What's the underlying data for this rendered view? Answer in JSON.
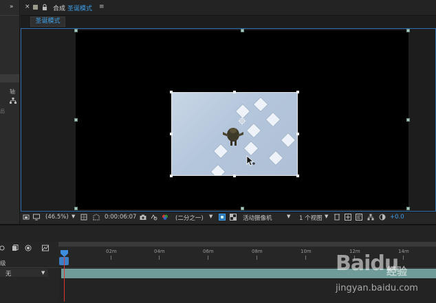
{
  "left_panel": {
    "collapse_glyph": "»",
    "partial_label": "轴",
    "small_glyph": "品",
    "icon": "network-icon"
  },
  "comp_panel": {
    "close_glyph": "×",
    "lock_glyph": "🔒",
    "panel_type": "合成",
    "comp_name": "圣诞模式",
    "menu_glyph": "≡",
    "tab_label": "圣诞模式"
  },
  "viewer_toolbar": {
    "zoom": "(46.5%)",
    "timecode": "0:00:06:07",
    "resolution": "(二分之一)",
    "camera": "活动摄像机",
    "views": "1 个视图",
    "exposure": "+0.0"
  },
  "timeline": {
    "ruler_labels": [
      "02m",
      "04m",
      "06m",
      "08m",
      "10m",
      "12m",
      "14m"
    ],
    "column_label": "级",
    "parent_value": "无"
  },
  "watermark": {
    "logo": "Baidu",
    "cn": "经验",
    "url": "jingyan.baidu.com"
  },
  "colors": {
    "accent": "#3d9fe8",
    "track": "#6f9c98",
    "playhead": "#dd3333",
    "frame": "#2a70b0"
  }
}
